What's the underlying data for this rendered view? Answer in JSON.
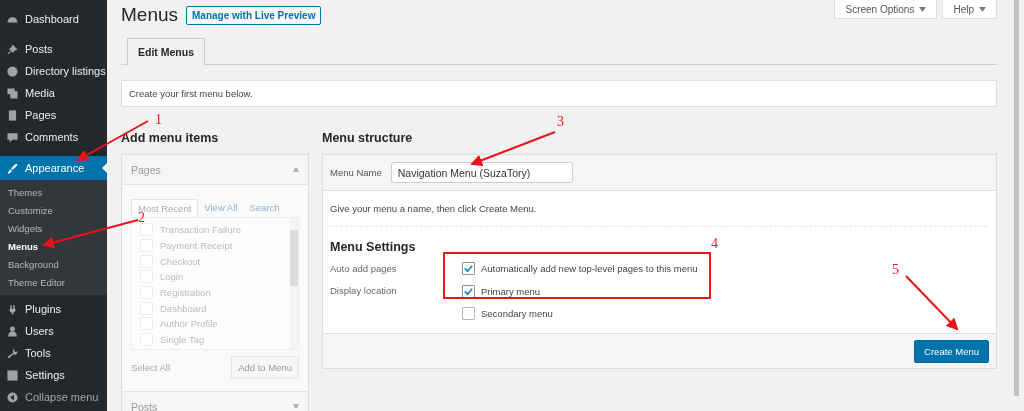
{
  "sidebar": {
    "items": [
      {
        "label": "Dashboard",
        "selected": false
      },
      {
        "label": "Posts",
        "selected": false
      },
      {
        "label": "Directory listings",
        "selected": false
      },
      {
        "label": "Media",
        "selected": false
      },
      {
        "label": "Pages",
        "selected": false
      },
      {
        "label": "Comments",
        "selected": false
      },
      {
        "label": "Appearance",
        "selected": true,
        "expanded": true,
        "children": [
          {
            "label": "Themes",
            "selected": false
          },
          {
            "label": "Customize",
            "selected": false
          },
          {
            "label": "Widgets",
            "selected": false
          },
          {
            "label": "Menus",
            "selected": true
          },
          {
            "label": "Background",
            "selected": false
          },
          {
            "label": "Theme Editor",
            "selected": false
          }
        ]
      },
      {
        "label": "Plugins",
        "selected": false
      },
      {
        "label": "Users",
        "selected": false
      },
      {
        "label": "Tools",
        "selected": false
      },
      {
        "label": "Settings",
        "selected": false
      }
    ],
    "collapse": "Collapse menu"
  },
  "header": {
    "title": "Menus",
    "live_preview": "Manage with Live Preview",
    "screen_options": "Screen Options",
    "help": "Help"
  },
  "tabs": [
    {
      "label": "Edit Menus",
      "selected": true
    }
  ],
  "notice": "Create your first menu below.",
  "add_menu_items": {
    "heading": "Add menu items",
    "panels": [
      {
        "title": "Pages",
        "expanded": true,
        "tabs": [
          {
            "label": "Most Recent",
            "selected": true
          },
          {
            "label": "View All",
            "selected": false
          },
          {
            "label": "Search",
            "selected": false
          }
        ],
        "items": [
          {
            "label": "Transaction Failure",
            "checked": false
          },
          {
            "label": "Payment Receipt",
            "checked": false
          },
          {
            "label": "Checkout",
            "checked": false
          },
          {
            "label": "Login",
            "checked": false
          },
          {
            "label": "Registration",
            "checked": false
          },
          {
            "label": "Dashboard",
            "checked": false
          },
          {
            "label": "Author Profile",
            "checked": false
          },
          {
            "label": "Single Tag",
            "checked": false
          }
        ],
        "select_all": "Select All",
        "add_button": {
          "label": "Add to Menu",
          "disabled": true
        }
      },
      {
        "title": "Posts",
        "expanded": false
      }
    ]
  },
  "menu_structure": {
    "heading": "Menu structure",
    "name_label": "Menu Name",
    "name_value": "Navigation Menu (SuzaTory)",
    "hint": "Give your menu a name, then click Create Menu.",
    "settings_heading": "Menu Settings",
    "settings": [
      {
        "label": "Auto add pages",
        "options": [
          {
            "label": "Automatically add new top-level pages to this menu",
            "checked": true
          }
        ]
      },
      {
        "label": "Display location",
        "options": [
          {
            "label": "Primary menu",
            "checked": true
          },
          {
            "label": "Secondary menu",
            "checked": false
          }
        ]
      }
    ],
    "create_button": "Create Menu"
  },
  "annotations": [
    {
      "number": "1"
    },
    {
      "number": "2"
    },
    {
      "number": "3"
    },
    {
      "number": "4"
    },
    {
      "number": "5"
    }
  ]
}
